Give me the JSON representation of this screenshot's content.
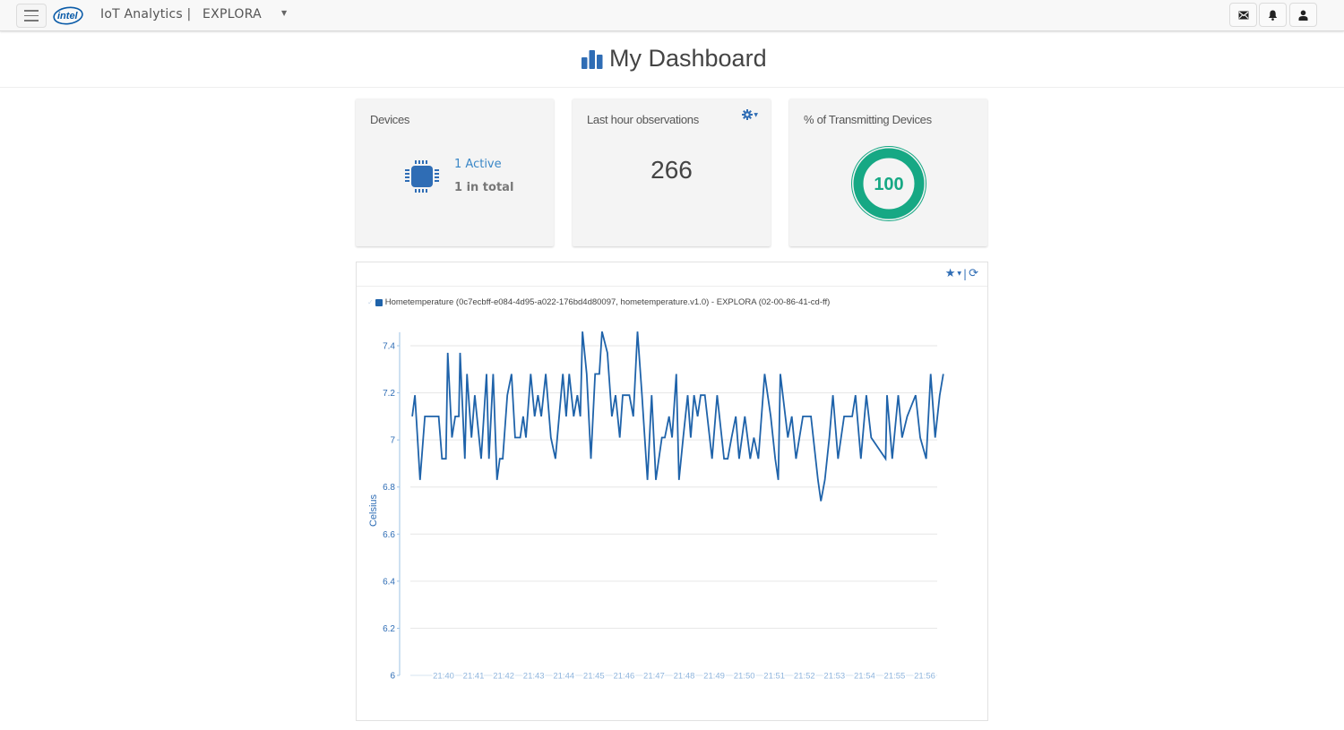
{
  "topbar": {
    "menu_icon": "hamburger-icon",
    "logo_text": "intel",
    "app_title": "IoT Analytics |",
    "account_name": "EXPLORA",
    "account_caret_icon": "caret-down-icon",
    "buttons": [
      {
        "name": "messages",
        "icon": "envelope-icon"
      },
      {
        "name": "notifications",
        "icon": "bell-icon"
      },
      {
        "name": "user",
        "icon": "user-icon"
      }
    ]
  },
  "header": {
    "title": "My Dashboard",
    "icon": "bar-chart-icon"
  },
  "cards": {
    "devices": {
      "title": "Devices",
      "icon": "chip-icon",
      "active": "1 Active",
      "total": "1 in total"
    },
    "observations": {
      "title": "Last hour observations",
      "value": "266",
      "settings_icon": "gear-icon"
    },
    "transmitting": {
      "title": "% of Transmitting Devices",
      "value": "100",
      "percent": 100
    }
  },
  "colors": {
    "accent": "#2f6db5",
    "line": "#1f63aa",
    "donut": "#16a884",
    "axis_text": "#2f6db5"
  },
  "chart_panel": {
    "tools": {
      "favorite_icon": "star-icon",
      "caret_icon": "caret-down-icon",
      "refresh_icon": "refresh-icon"
    },
    "legend_label": "Hometemperature (0c7ecbff-e084-4d95-a022-176bd4d80097, hometemperature.v1.0) - EXPLORA (02-00-86-41-cd-ff)"
  },
  "chart_data": {
    "type": "line",
    "title": "",
    "xlabel": "",
    "ylabel": "Celsius",
    "ylim": [
      6,
      7.45
    ],
    "yticks": [
      6,
      6.2,
      6.4,
      6.6,
      6.8,
      7,
      7.2,
      7.4
    ],
    "ytick_labels": [
      "6",
      "6.2",
      "6.4",
      "6.6",
      "6.8",
      "7",
      "7.2",
      "7.4"
    ],
    "xlim_minutes": [
      -1.05,
      16.4
    ],
    "xticks_minutes": [
      0,
      1,
      2,
      3,
      4,
      5,
      6,
      7,
      8,
      9,
      10,
      11,
      12,
      13,
      14,
      15,
      16
    ],
    "xtick_labels": [
      "21:40",
      "21:41",
      "21:42",
      "21:43",
      "21:44",
      "21:45",
      "21:46",
      "21:47",
      "21:48",
      "21:49",
      "21:50",
      "21:51",
      "21:52",
      "21:53",
      "21:54",
      "21:55",
      "21:56"
    ],
    "x_unit": "minutes after 21:40",
    "grid": true,
    "legend_position": "top-left",
    "series": [
      {
        "name": "Hometemperature",
        "points": [
          [
            -1.04,
            7.1
          ],
          [
            -0.95,
            7.19
          ],
          [
            -0.78,
            6.83
          ],
          [
            -0.62,
            7.1
          ],
          [
            -0.16,
            7.1
          ],
          [
            -0.05,
            6.92
          ],
          [
            0.08,
            6.92
          ],
          [
            0.14,
            7.37
          ],
          [
            0.28,
            7.01
          ],
          [
            0.39,
            7.1
          ],
          [
            0.51,
            7.1
          ],
          [
            0.55,
            7.37
          ],
          [
            0.71,
            6.92
          ],
          [
            0.78,
            7.28
          ],
          [
            0.93,
            7.01
          ],
          [
            1.04,
            7.19
          ],
          [
            1.25,
            6.92
          ],
          [
            1.43,
            7.28
          ],
          [
            1.51,
            6.92
          ],
          [
            1.65,
            7.28
          ],
          [
            1.78,
            6.83
          ],
          [
            1.87,
            6.92
          ],
          [
            1.97,
            6.92
          ],
          [
            2.12,
            7.19
          ],
          [
            2.26,
            7.28
          ],
          [
            2.38,
            7.01
          ],
          [
            2.55,
            7.01
          ],
          [
            2.65,
            7.1
          ],
          [
            2.74,
            7.01
          ],
          [
            2.9,
            7.28
          ],
          [
            3.03,
            7.1
          ],
          [
            3.14,
            7.19
          ],
          [
            3.25,
            7.1
          ],
          [
            3.4,
            7.28
          ],
          [
            3.57,
            7.01
          ],
          [
            3.72,
            6.92
          ],
          [
            3.97,
            7.28
          ],
          [
            4.08,
            7.1
          ],
          [
            4.18,
            7.28
          ],
          [
            4.33,
            7.1
          ],
          [
            4.45,
            7.19
          ],
          [
            4.55,
            7.1
          ],
          [
            4.62,
            7.46
          ],
          [
            4.76,
            7.28
          ],
          [
            4.9,
            6.92
          ],
          [
            5.04,
            7.28
          ],
          [
            5.18,
            7.28
          ],
          [
            5.27,
            7.46
          ],
          [
            5.45,
            7.37
          ],
          [
            5.6,
            7.1
          ],
          [
            5.72,
            7.19
          ],
          [
            5.86,
            7.01
          ],
          [
            5.96,
            7.19
          ],
          [
            6.18,
            7.19
          ],
          [
            6.31,
            7.1
          ],
          [
            6.45,
            7.46
          ],
          [
            6.6,
            7.19
          ],
          [
            6.78,
            6.83
          ],
          [
            6.92,
            7.19
          ],
          [
            7.06,
            6.83
          ],
          [
            7.26,
            7.01
          ],
          [
            7.36,
            7.01
          ],
          [
            7.5,
            7.1
          ],
          [
            7.6,
            7.01
          ],
          [
            7.74,
            7.28
          ],
          [
            7.83,
            6.83
          ],
          [
            7.97,
            7.01
          ],
          [
            8.12,
            7.19
          ],
          [
            8.22,
            7.01
          ],
          [
            8.33,
            7.19
          ],
          [
            8.45,
            7.1
          ],
          [
            8.55,
            7.19
          ],
          [
            8.69,
            7.19
          ],
          [
            8.93,
            6.92
          ],
          [
            9.1,
            7.19
          ],
          [
            9.33,
            6.92
          ],
          [
            9.45,
            6.92
          ],
          [
            9.58,
            7.01
          ],
          [
            9.72,
            7.1
          ],
          [
            9.83,
            6.92
          ],
          [
            10.02,
            7.1
          ],
          [
            10.2,
            6.92
          ],
          [
            10.32,
            7.01
          ],
          [
            10.47,
            6.92
          ],
          [
            10.68,
            7.28
          ],
          [
            10.88,
            7.1
          ],
          [
            11.03,
            6.92
          ],
          [
            11.13,
            6.83
          ],
          [
            11.2,
            7.28
          ],
          [
            11.45,
            7.01
          ],
          [
            11.58,
            7.1
          ],
          [
            11.72,
            6.92
          ],
          [
            11.95,
            7.1
          ],
          [
            12.1,
            7.1
          ],
          [
            12.22,
            7.1
          ],
          [
            12.45,
            6.83
          ],
          [
            12.55,
            6.74
          ],
          [
            12.68,
            6.83
          ],
          [
            12.83,
            7.01
          ],
          [
            12.95,
            7.19
          ],
          [
            13.12,
            6.92
          ],
          [
            13.32,
            7.1
          ],
          [
            13.59,
            7.1
          ],
          [
            13.7,
            7.19
          ],
          [
            13.88,
            6.92
          ],
          [
            14.06,
            7.19
          ],
          [
            14.22,
            7.01
          ],
          [
            14.7,
            6.92
          ],
          [
            14.75,
            7.19
          ],
          [
            14.92,
            6.92
          ],
          [
            15.12,
            7.19
          ],
          [
            15.25,
            7.01
          ],
          [
            15.42,
            7.1
          ],
          [
            15.7,
            7.19
          ],
          [
            15.85,
            7.01
          ],
          [
            16.05,
            6.92
          ],
          [
            16.2,
            7.28
          ],
          [
            16.35,
            7.01
          ],
          [
            16.5,
            7.19
          ],
          [
            16.62,
            7.28
          ]
        ]
      }
    ]
  }
}
